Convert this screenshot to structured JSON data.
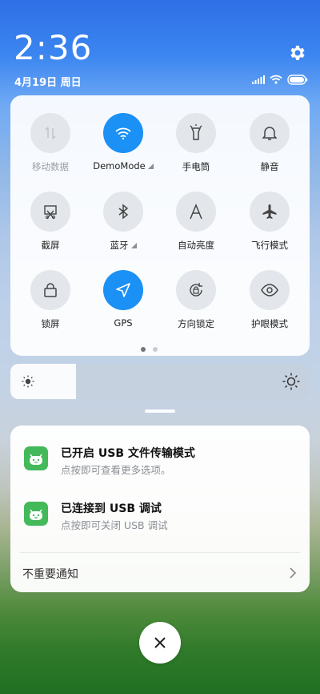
{
  "status": {
    "time": "2:36",
    "date": "4月19日 周日"
  },
  "tiles": [
    {
      "label": "移动数据",
      "icon": "mobile-data-icon",
      "active": false,
      "disabled": true
    },
    {
      "label": "DemoMode",
      "icon": "wifi-icon",
      "active": true,
      "disabled": false
    },
    {
      "label": "手电筒",
      "icon": "flashlight-icon",
      "active": false,
      "disabled": false
    },
    {
      "label": "静音",
      "icon": "bell-icon",
      "active": false,
      "disabled": false
    },
    {
      "label": "截屏",
      "icon": "screenshot-icon",
      "active": false,
      "disabled": false
    },
    {
      "label": "蓝牙",
      "icon": "bluetooth-icon",
      "active": false,
      "disabled": false
    },
    {
      "label": "自动亮度",
      "icon": "auto-brightness-icon",
      "active": false,
      "disabled": false
    },
    {
      "label": "飞行模式",
      "icon": "airplane-icon",
      "active": false,
      "disabled": false
    },
    {
      "label": "锁屏",
      "icon": "lock-icon",
      "active": false,
      "disabled": false
    },
    {
      "label": "GPS",
      "icon": "location-icon",
      "active": true,
      "disabled": false
    },
    {
      "label": "方向锁定",
      "icon": "rotation-lock-icon",
      "active": false,
      "disabled": false
    },
    {
      "label": "护眼模式",
      "icon": "eye-icon",
      "active": false,
      "disabled": false
    }
  ],
  "brightness": {
    "level": 0.22
  },
  "notifications": [
    {
      "title": "已开启 USB 文件传输模式",
      "subtitle": "点按即可查看更多选项。"
    },
    {
      "title": "已连接到 USB 调试",
      "subtitle": "点按即可关闭 USB 调试"
    }
  ],
  "footer": {
    "unimportant": "不重要通知"
  },
  "colors": {
    "accent": "#1b90f5",
    "app_green": "#43b95a"
  }
}
